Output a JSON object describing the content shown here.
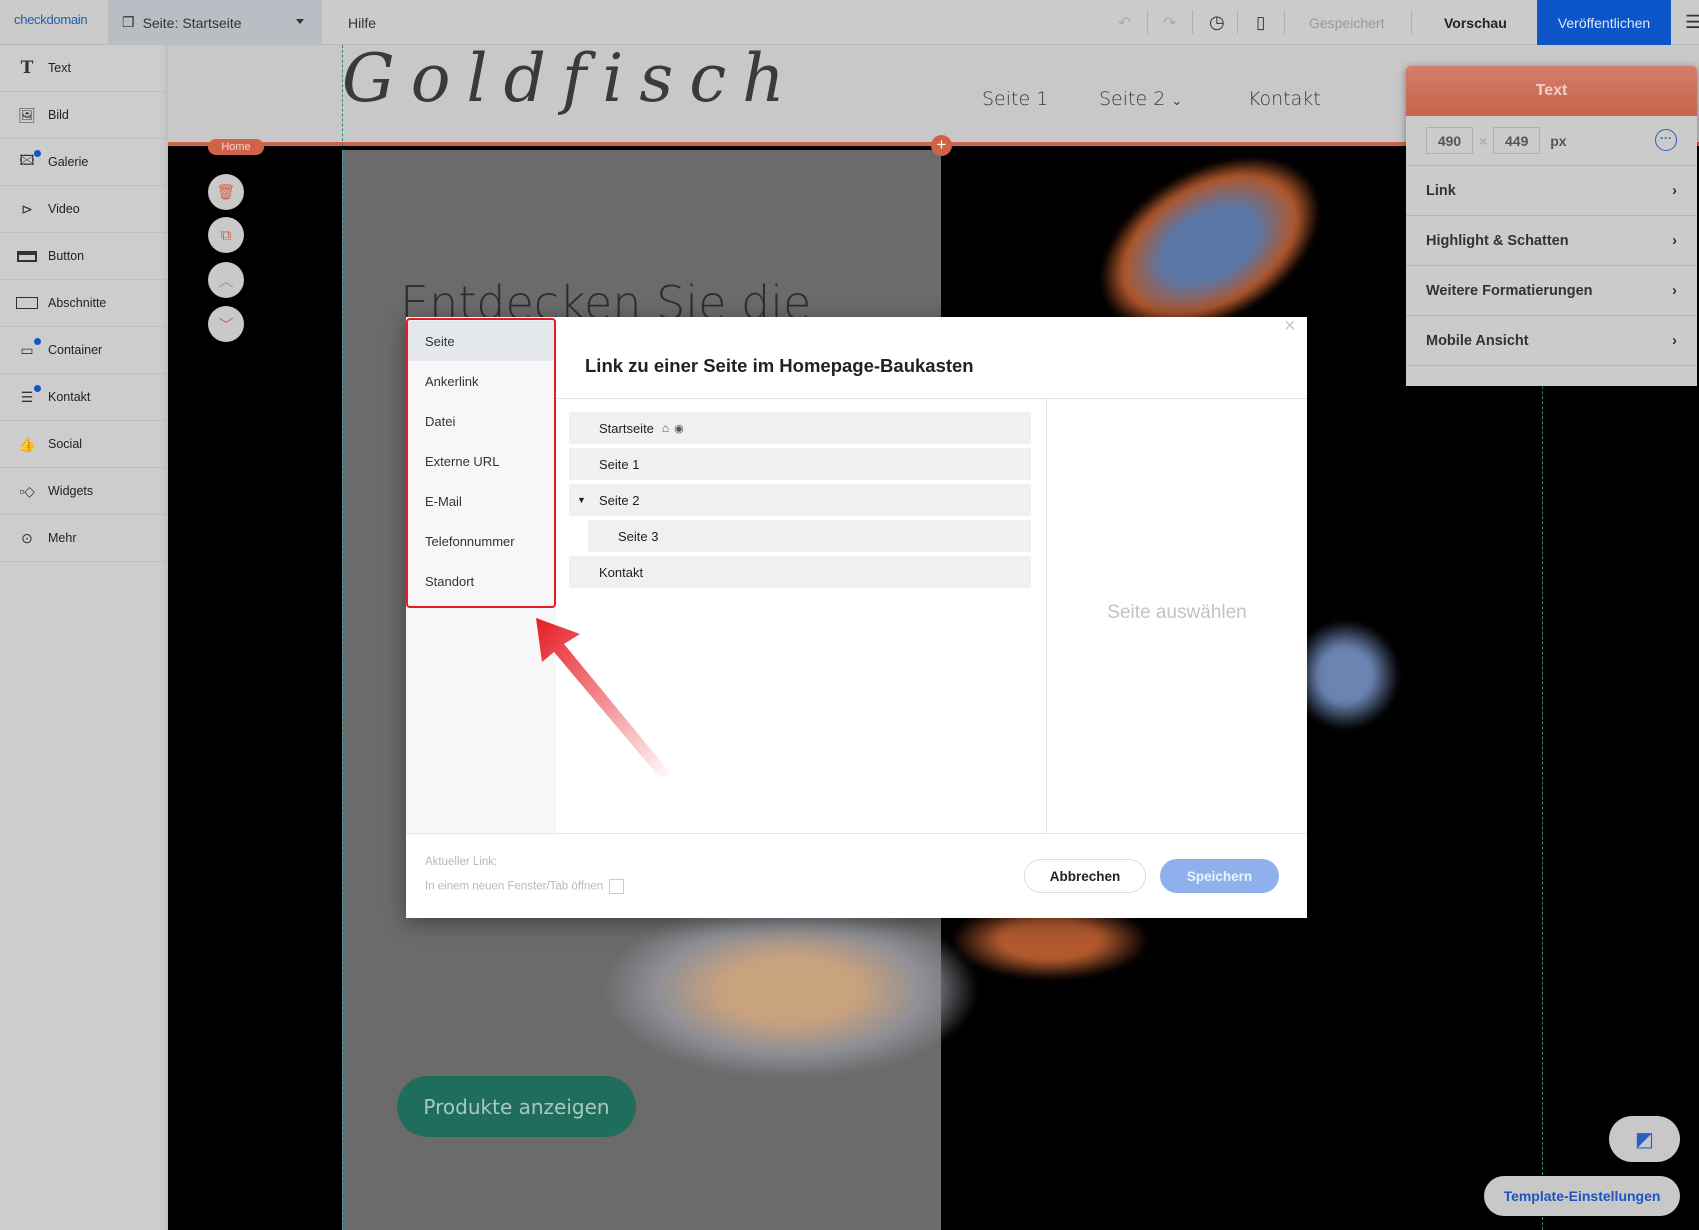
{
  "topbar": {
    "logo": "checkdomain",
    "page_prefix": "Seite:",
    "page_value": "Startseite",
    "help": "Hilfe",
    "saved": "Gespeichert",
    "preview": "Vorschau",
    "publish": "Veröffentlichen",
    "publish_color": "#0b55c8"
  },
  "sidebar": {
    "items": [
      {
        "label": "Text",
        "icon": "text-icon"
      },
      {
        "label": "Bild",
        "icon": "image-icon"
      },
      {
        "label": "Galerie",
        "icon": "gallery-icon"
      },
      {
        "label": "Video",
        "icon": "video-icon"
      },
      {
        "label": "Button",
        "icon": "button-icon"
      },
      {
        "label": "Abschnitte",
        "icon": "section-icon"
      },
      {
        "label": "Container",
        "icon": "container-icon"
      },
      {
        "label": "Kontakt",
        "icon": "contact-icon"
      },
      {
        "label": "Social",
        "icon": "thumbs-up-icon"
      },
      {
        "label": "Widgets",
        "icon": "widgets-icon"
      },
      {
        "label": "Mehr",
        "icon": "more-icon"
      }
    ]
  },
  "site": {
    "logo_text": "Goldfisch",
    "nav": [
      "Seite 1",
      "Seite 2",
      "Kontakt"
    ],
    "home_badge": "Home",
    "heading": "Entdecken Sie die",
    "cta": "Produkte anzeigen",
    "accent": "#d0624a"
  },
  "panel": {
    "title": "Text",
    "width": "490",
    "height": "449",
    "unit": "px",
    "items": [
      "Link",
      "Highlight & Schatten",
      "Weitere Formatierungen",
      "Mobile Ansicht"
    ]
  },
  "dialog": {
    "menu": [
      "Seite",
      "Ankerlink",
      "Datei",
      "Externe URL",
      "E-Mail",
      "Telefonnummer",
      "Standort"
    ],
    "selected_menu": "Seite",
    "title": "Link zu einer Seite im Homepage-Baukasten",
    "pages": [
      {
        "label": "Startseite"
      },
      {
        "label": "Seite 1"
      },
      {
        "label": "Seite 2",
        "expanded": true
      },
      {
        "label": "Seite 3",
        "child": true
      },
      {
        "label": "Kontakt"
      }
    ],
    "placeholder": "Seite auswählen",
    "current_link_label": "Aktueller Link:",
    "new_tab_label": "In einem neuen Fenster/Tab öffnen",
    "new_tab_checked": false,
    "cancel": "Abbrechen",
    "save": "Speichern"
  },
  "bottom": {
    "template_settings": "Template-Einstellungen"
  }
}
